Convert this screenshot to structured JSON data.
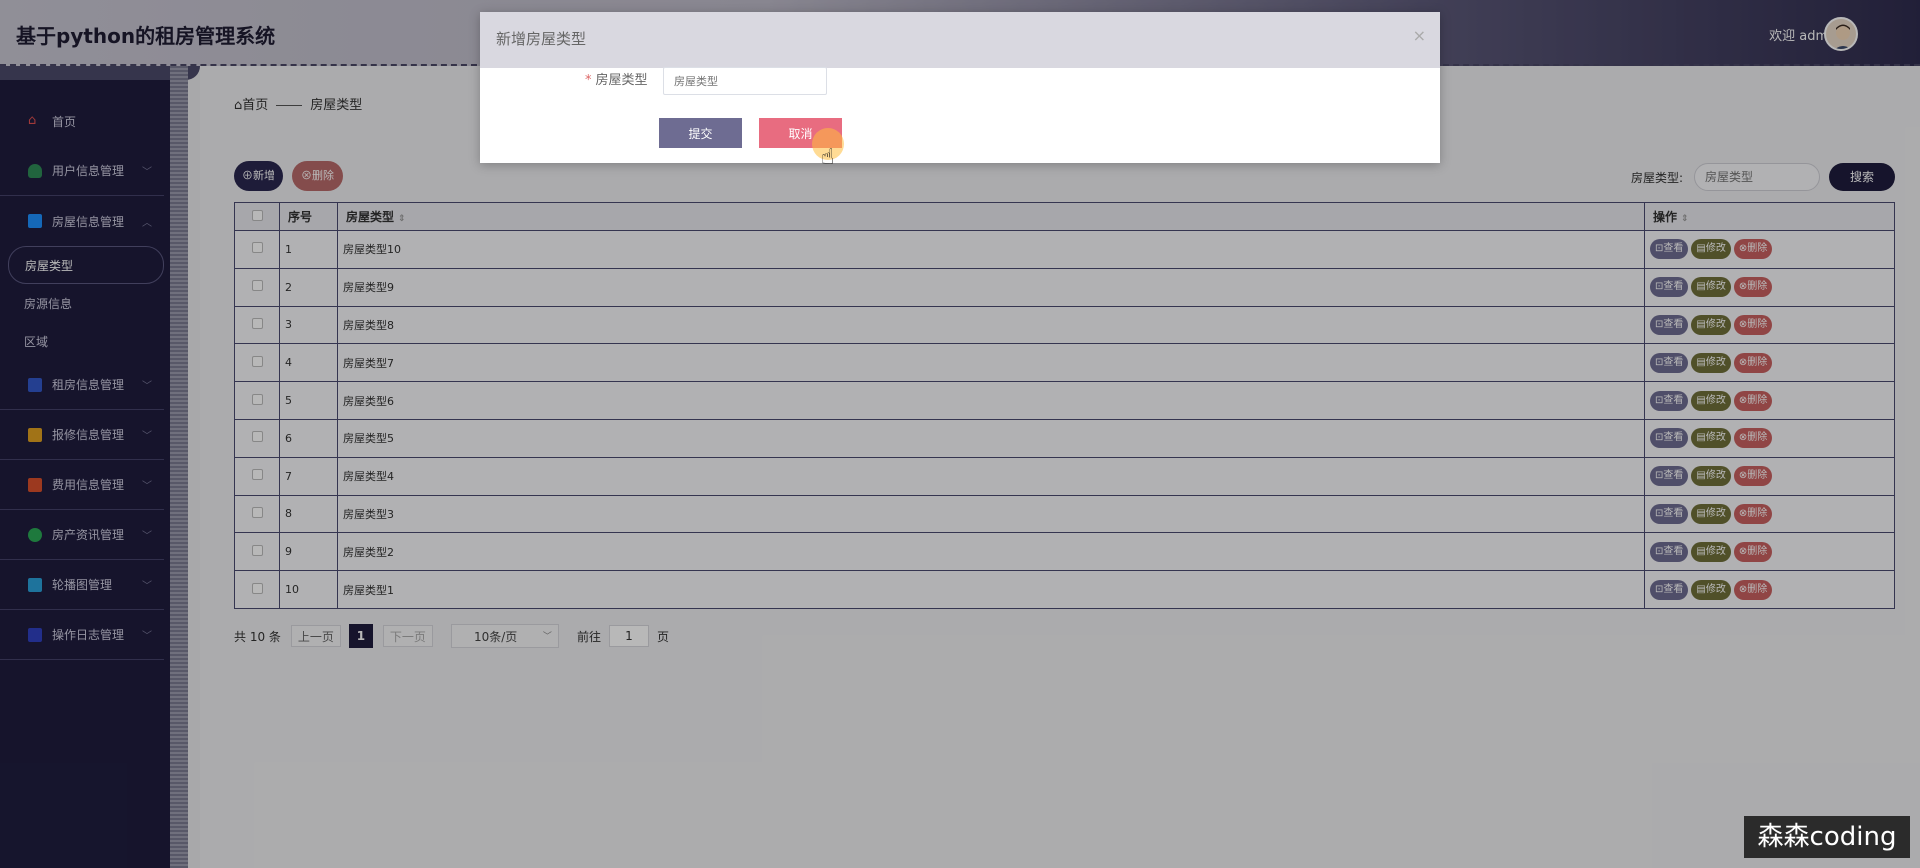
{
  "header": {
    "app_title": "基于python的租房管理系统",
    "welcome": "欢迎 admin"
  },
  "sidebar": {
    "home": "首页",
    "groups": [
      {
        "label": "用户信息管理",
        "icon": "user-icon",
        "color": "#2e8b57"
      },
      {
        "label": "房屋信息管理",
        "icon": "house-icon",
        "color": "#1e90ff"
      },
      {
        "label": "租房信息管理",
        "icon": "book-icon",
        "color": "#3358c8"
      },
      {
        "label": "报修信息管理",
        "icon": "toolbox-icon",
        "color": "#e0a020"
      },
      {
        "label": "费用信息管理",
        "icon": "wallet-icon",
        "color": "#d9502c"
      },
      {
        "label": "房产资讯管理",
        "icon": "globe-icon",
        "color": "#2aa855"
      },
      {
        "label": "轮播图管理",
        "icon": "image-icon",
        "color": "#2aa0d8"
      },
      {
        "label": "操作日志管理",
        "icon": "flag-icon",
        "color": "#3040c0"
      }
    ],
    "subitems": [
      "房屋类型",
      "房源信息",
      "区域"
    ]
  },
  "breadcrumb": {
    "home": "首页",
    "current": "房屋类型"
  },
  "toolbar": {
    "add": "⊕新增",
    "delete": "⊗删除"
  },
  "search": {
    "label": "房屋类型:",
    "placeholder": "房屋类型",
    "button": "搜索"
  },
  "table": {
    "headers": {
      "index": "序号",
      "type": "房屋类型",
      "ops": "操作"
    },
    "ops": {
      "view": "⊡查看",
      "edit": "▤修改",
      "del": "⊗删除"
    },
    "rows": [
      {
        "index": "1",
        "type": "房屋类型10"
      },
      {
        "index": "2",
        "type": "房屋类型9"
      },
      {
        "index": "3",
        "type": "房屋类型8"
      },
      {
        "index": "4",
        "type": "房屋类型7"
      },
      {
        "index": "5",
        "type": "房屋类型6"
      },
      {
        "index": "6",
        "type": "房屋类型5"
      },
      {
        "index": "7",
        "type": "房屋类型4"
      },
      {
        "index": "8",
        "type": "房屋类型3"
      },
      {
        "index": "9",
        "type": "房屋类型2"
      },
      {
        "index": "10",
        "type": "房屋类型1"
      }
    ]
  },
  "pagination": {
    "total": "共 10 条",
    "prev": "上一页",
    "current": "1",
    "next": "下一页",
    "page_size": "10条/页",
    "goto_prefix": "前往",
    "goto_value": "1",
    "goto_suffix": "页"
  },
  "dialog": {
    "title": "新增房屋类型",
    "field_label": "房屋类型",
    "field_placeholder": "房屋类型",
    "submit": "提交",
    "cancel": "取消"
  },
  "watermark": "森森coding"
}
